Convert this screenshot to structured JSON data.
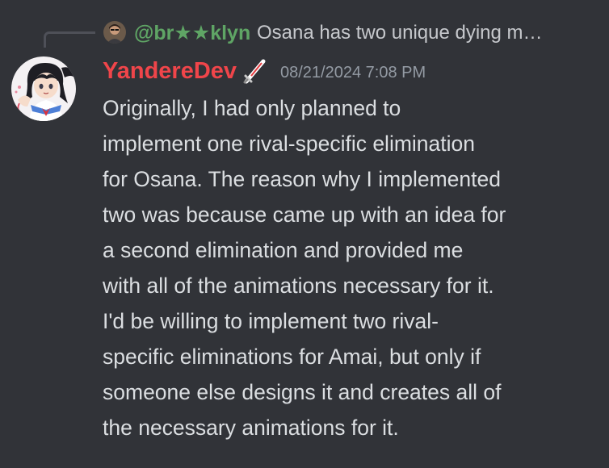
{
  "reply": {
    "username": "@br★★klyn",
    "preview": "Osana has two unique dying m…",
    "username_color": "#5fa565"
  },
  "message": {
    "author": "YandereDev",
    "author_color": "#f0454a",
    "role_icon": "sword-icon",
    "timestamp": "08/21/2024 7:08 PM",
    "text": "Originally, I had only planned to\nimplement one rival-specific elimination\nfor Osana. The reason why I implemented\ntwo was because came up with an idea for\na second elimination and provided me\nwith all of the animations necessary for it.\nI'd be willing to implement two rival-\nspecific eliminations for Amai, but only if\nsomeone else designs it and creates all of\nthe necessary animations for it.",
    "text_color": "#dbdee1"
  },
  "theme": {
    "background": "#313338",
    "timestamp_color": "#949ba4",
    "spine_color": "#4e5058"
  }
}
